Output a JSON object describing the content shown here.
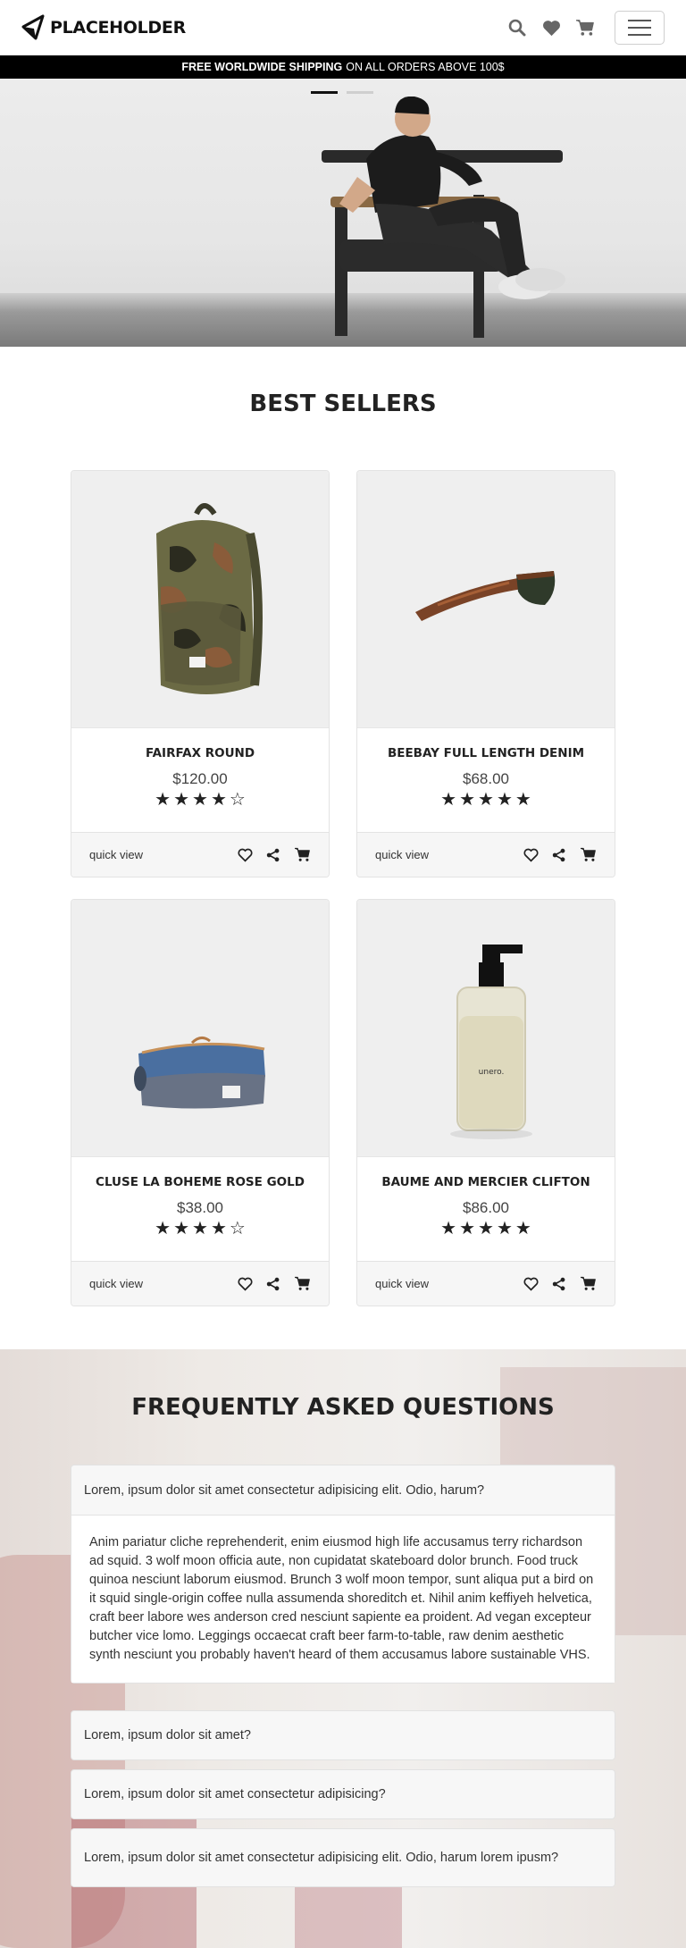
{
  "navbar": {
    "brand": "PLACEHOLDER",
    "icons": [
      "search-icon",
      "heart-icon",
      "cart-icon",
      "menu-icon"
    ]
  },
  "promo": {
    "bold": "FREE WORLDWIDE SHIPPING",
    "rest": "ON ALL ORDERS ABOVE 100$"
  },
  "hero": {
    "slides": 2,
    "active_slide": 1
  },
  "best_sellers": {
    "title": "BEST SELLERS",
    "products": [
      {
        "name": "FAIRFAX ROUND",
        "price": "$120.00",
        "rating": 4,
        "max_rating": 5,
        "quick_view": "quick view"
      },
      {
        "name": "BEEBAY FULL LENGTH DENIM",
        "price": "$68.00",
        "rating": 5,
        "max_rating": 5,
        "quick_view": "quick view"
      },
      {
        "name": "CLUSE LA BOHEME ROSE GOLD",
        "price": "$38.00",
        "rating": 4,
        "max_rating": 5,
        "quick_view": "quick view"
      },
      {
        "name": "BAUME AND MERCIER CLIFTON",
        "price": "$86.00",
        "rating": 5,
        "max_rating": 5,
        "quick_view": "quick view"
      }
    ]
  },
  "faq": {
    "title": "FREQUENTLY ASKED QUESTIONS",
    "items": [
      {
        "question": "Lorem, ipsum dolor sit amet consectetur adipisicing elit. Odio, harum?",
        "answer": "Anim pariatur cliche reprehenderit, enim eiusmod high life accusamus terry richardson ad squid. 3 wolf moon officia aute, non cupidatat skateboard dolor brunch. Food truck quinoa nesciunt laborum eiusmod. Brunch 3 wolf moon tempor, sunt aliqua put a bird on it squid single-origin coffee nulla assumenda shoreditch et. Nihil anim keffiyeh helvetica, craft beer labore wes anderson cred nesciunt sapiente ea proident. Ad vegan excepteur butcher vice lomo. Leggings occaecat craft beer farm-to-table, raw denim aesthetic synth nesciunt you probably haven't heard of them accusamus labore sustainable VHS."
      },
      {
        "question": "Lorem, ipsum dolor sit amet?"
      },
      {
        "question": "Lorem, ipsum dolor sit amet consectetur adipisicing?"
      },
      {
        "question": "Lorem, ipsum dolor sit amet consectetur adipisicing elit. Odio, harum lorem ipusm?"
      }
    ]
  },
  "colors": {
    "promo_bg": "#000000",
    "text_dark": "#222222",
    "card_bg": "#efefef",
    "footer_bg": "#f6f6f6"
  }
}
